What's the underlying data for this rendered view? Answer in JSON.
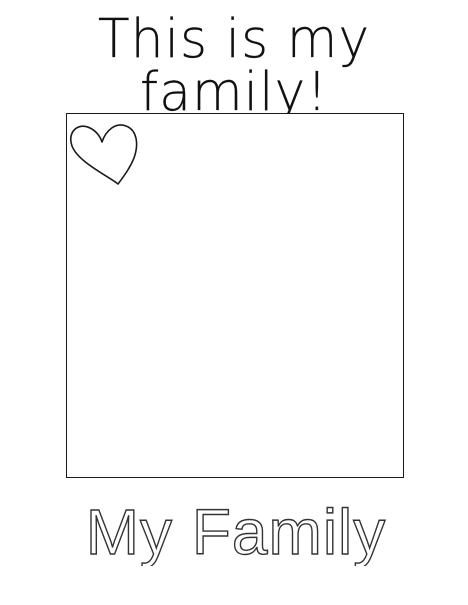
{
  "page": {
    "title": "This is my family!",
    "footer_label": "My Family"
  },
  "icons": {
    "heart": "heart-icon"
  },
  "colors": {
    "ink": "#1a1a1a",
    "paper": "#ffffff"
  }
}
